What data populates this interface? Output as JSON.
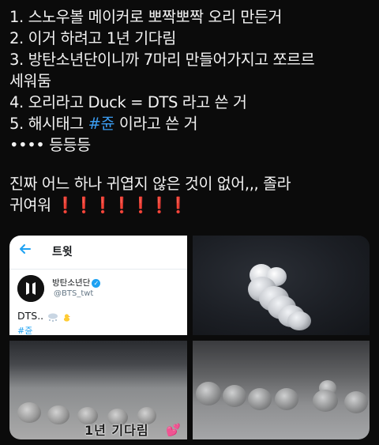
{
  "tweet": {
    "lines": [
      "1. 스노우볼 메이커로 뽀짝뽀짝 오리 만든거",
      "2. 이거 하려고 1년 기다림",
      "3. 방탄소년단이니까 7마리 만들어가지고 쪼르르",
      "세워둠",
      "4. 오리라고 Duck = DTS 라고 쓴 거"
    ],
    "line5_prefix": "5. 해시태그 ",
    "line5_hashtag": "#쥰",
    "line5_suffix": " 이라고 쓴 거",
    "line6": "•••• 등등등",
    "para2_line1": "진짜 어느 하나 귀엽지 않은 것이 없어,,, 졸라",
    "para2_line2": "귀여워",
    "exclaim_marks": "❗❗❗❗❗❗❗"
  },
  "media": {
    "embedded_tweet": {
      "back_icon": "arrow-left-icon",
      "header_title": "트윗",
      "account_name": "방탄소년단",
      "verified_icon": "verified-badge-icon",
      "handle": "@BTS_twt",
      "body_text": "DTS..",
      "hashtag": "#쥰"
    },
    "photo3_caption": "1년 기다림",
    "photo3_sticker": "💕",
    "accent_color": "#1da1f2",
    "hashtag_color": "#3b9cf0"
  }
}
